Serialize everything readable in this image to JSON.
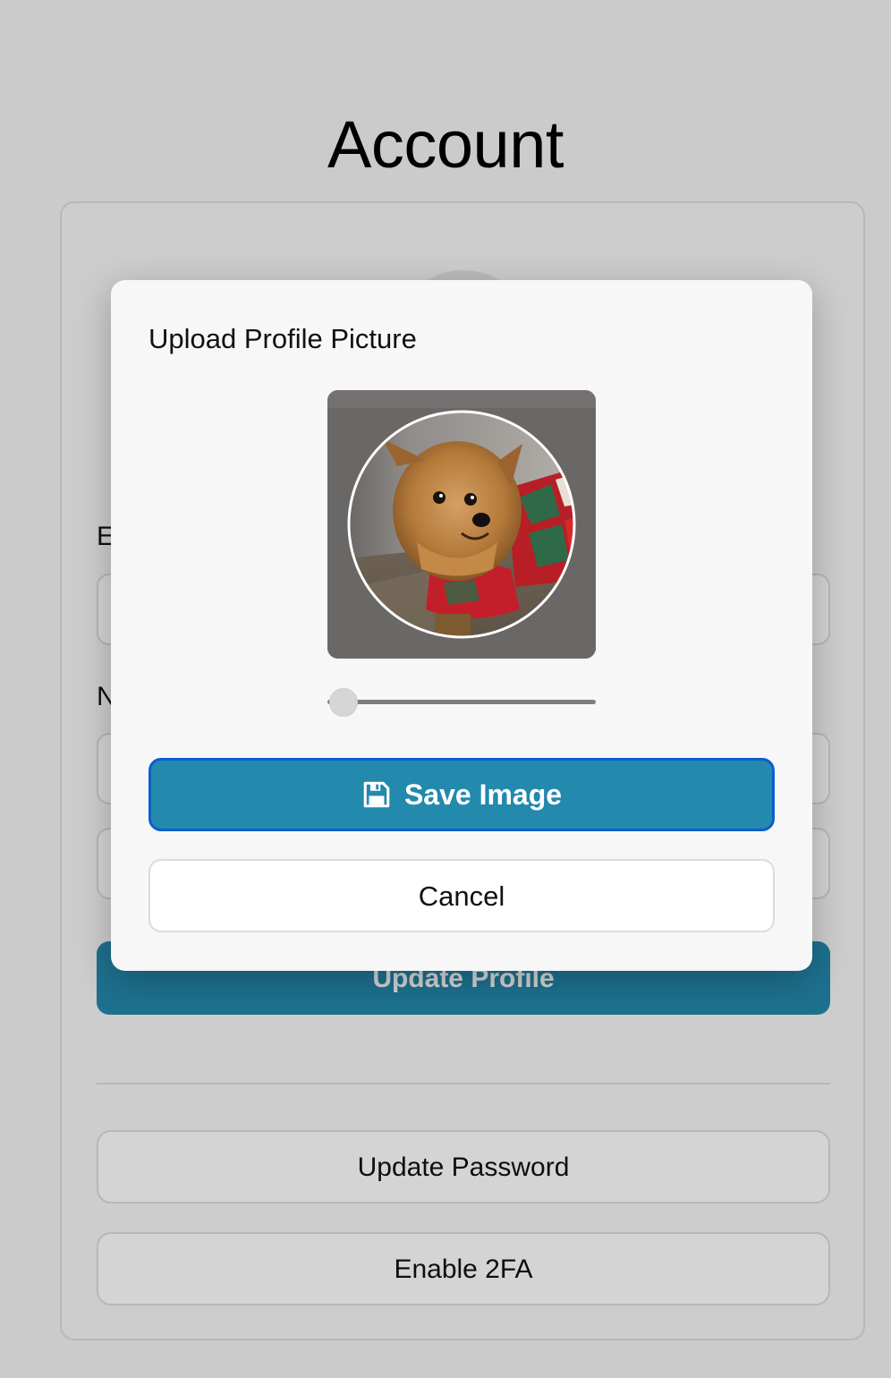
{
  "page": {
    "title": "Account"
  },
  "form": {
    "email_label": "E",
    "name_label": "N",
    "update_profile_label": "Update Profile"
  },
  "security": {
    "update_password_label": "Update Password",
    "enable_2fa_label": "Enable 2FA"
  },
  "modal": {
    "title": "Upload Profile Picture",
    "image_alt": "Dog wearing a red and green sweater",
    "zoom_level": 0.06,
    "save_label": "Save Image",
    "cancel_label": "Cancel"
  },
  "icons": {
    "save": "floppy-disk-icon"
  },
  "colors": {
    "primary": "#2389ad",
    "focus_ring": "#0b5fcf",
    "overlay": "rgba(0,0,0,0.17)"
  }
}
